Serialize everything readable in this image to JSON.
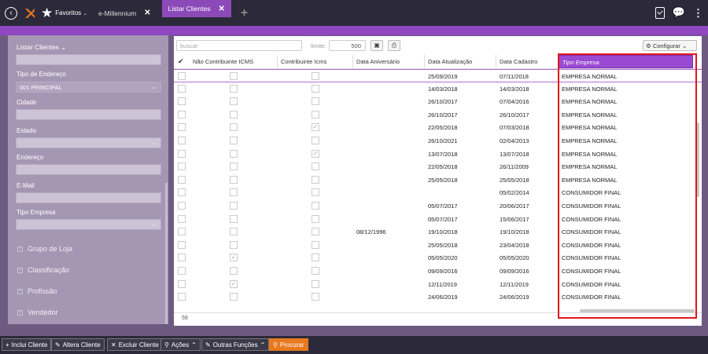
{
  "topbar": {
    "favorites_label": "Favoritos",
    "tabs": [
      {
        "label": "e-Millennium",
        "active": false
      },
      {
        "label": "Listar Clientes",
        "active": true
      }
    ]
  },
  "sidebar": {
    "title": "Listar Clientes",
    "fields": [
      {
        "label": "",
        "value": ""
      },
      {
        "label": "Tipo de Endereço",
        "value": "001 PRINCIPAL",
        "select": true
      },
      {
        "label": "Cidade",
        "value": ""
      },
      {
        "label": "Estado",
        "value": "",
        "select": true
      },
      {
        "label": "Endereço",
        "value": ""
      },
      {
        "label": "E-Mail",
        "value": ""
      },
      {
        "label": "Tipo Empresa",
        "value": "",
        "select": true
      }
    ],
    "groups": [
      "Grupo de Loja",
      "Classificação",
      "Profissão",
      "Vendedor"
    ]
  },
  "toolbar": {
    "search_placeholder": "buscar",
    "limit_label": "limite:",
    "limit_value": "500",
    "config_label": "Configurar"
  },
  "table": {
    "columns": [
      "Não Contribuinte ICMS",
      "Contribuinte Icms",
      "Data Aniversário",
      "Data Atualização",
      "Data Cadastro",
      "Tipo Empresa"
    ],
    "rows": [
      {
        "nci": false,
        "ci": false,
        "aniv": "",
        "atual": "25/09/2019",
        "cad": "07/11/2018",
        "tipo": "EMPRESA NORMAL"
      },
      {
        "nci": false,
        "ci": false,
        "aniv": "",
        "atual": "14/03/2018",
        "cad": "14/03/2018",
        "tipo": "EMPRESA NORMAL"
      },
      {
        "nci": false,
        "ci": false,
        "aniv": "",
        "atual": "26/10/2017",
        "cad": "07/04/2016",
        "tipo": "EMPRESA NORMAL"
      },
      {
        "nci": false,
        "ci": false,
        "aniv": "",
        "atual": "26/10/2017",
        "cad": "26/10/2017",
        "tipo": "EMPRESA NORMAL"
      },
      {
        "nci": false,
        "ci": true,
        "aniv": "",
        "atual": "22/05/2018",
        "cad": "07/03/2018",
        "tipo": "EMPRESA NORMAL"
      },
      {
        "nci": false,
        "ci": false,
        "aniv": "",
        "atual": "26/10/2021",
        "cad": "02/04/2013",
        "tipo": "EMPRESA NORMAL"
      },
      {
        "nci": false,
        "ci": true,
        "aniv": "",
        "atual": "13/07/2018",
        "cad": "13/07/2018",
        "tipo": "EMPRESA NORMAL"
      },
      {
        "nci": false,
        "ci": false,
        "aniv": "",
        "atual": "22/05/2018",
        "cad": "26/11/2009",
        "tipo": "EMPRESA NORMAL"
      },
      {
        "nci": false,
        "ci": false,
        "aniv": "",
        "atual": "25/05/2018",
        "cad": "25/05/2018",
        "tipo": "EMPRESA NORMAL"
      },
      {
        "nci": false,
        "ci": false,
        "aniv": "",
        "atual": "",
        "cad": "05/02/2014",
        "tipo": "CONSUMIDOR FINAL"
      },
      {
        "nci": false,
        "ci": false,
        "aniv": "",
        "atual": "05/07/2017",
        "cad": "20/06/2017",
        "tipo": "CONSUMIDOR FINAL"
      },
      {
        "nci": false,
        "ci": false,
        "aniv": "",
        "atual": "05/07/2017",
        "cad": "15/06/2017",
        "tipo": "CONSUMIDOR FINAL"
      },
      {
        "nci": false,
        "ci": false,
        "aniv": "08/12/1996",
        "atual": "19/10/2018",
        "cad": "19/10/2018",
        "tipo": "CONSUMIDOR FINAL"
      },
      {
        "nci": false,
        "ci": false,
        "aniv": "",
        "atual": "25/05/2018",
        "cad": "23/04/2018",
        "tipo": "CONSUMIDOR FINAL"
      },
      {
        "nci": true,
        "ci": false,
        "aniv": "",
        "atual": "05/05/2020",
        "cad": "05/05/2020",
        "tipo": "CONSUMIDOR FINAL"
      },
      {
        "nci": false,
        "ci": false,
        "aniv": "",
        "atual": "09/09/2016",
        "cad": "09/09/2016",
        "tipo": "CONSUMIDOR FINAL"
      },
      {
        "nci": true,
        "ci": false,
        "aniv": "",
        "atual": "12/11/2019",
        "cad": "12/11/2019",
        "tipo": "CONSUMIDOR FINAL"
      },
      {
        "nci": false,
        "ci": false,
        "aniv": "",
        "atual": "24/06/2019",
        "cad": "24/06/2019",
        "tipo": "CONSUMIDOR FINAL"
      }
    ],
    "count": "59"
  },
  "bottombar": {
    "buttons": [
      {
        "label": "Inclui Cliente",
        "icon": "+"
      },
      {
        "label": "Altera Cliente",
        "icon": "✎"
      },
      {
        "label": "Excluir Cliente",
        "icon": "✕"
      },
      {
        "label": "Ações",
        "icon": "⚲",
        "caret": true
      },
      {
        "label": "Outras Funções",
        "icon": "✎",
        "caret": true
      },
      {
        "label": "Procurar",
        "icon": "⚲",
        "orange": true
      }
    ]
  },
  "colors": {
    "topbar": "#2c2a3a",
    "accent": "#8f48c0",
    "highlight_header": "#9a4ad2",
    "selection_box": "#e5141c",
    "search_button": "#e8791f"
  }
}
